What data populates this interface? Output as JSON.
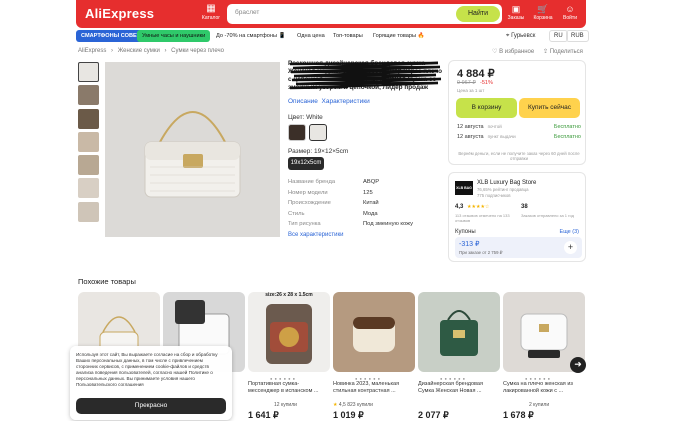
{
  "header": {
    "logo": "AliExpress",
    "catalog_label": "Каталог",
    "search_placeholder": "браслет",
    "search_button": "Найти",
    "icons": [
      {
        "label": "Заказы",
        "icon": "package-icon"
      },
      {
        "label": "Корзина",
        "icon": "cart-icon"
      },
      {
        "label": "Войти",
        "icon": "user-icon"
      }
    ]
  },
  "nav": {
    "chips": [
      "СМАРТФОНЫ СОВЕТ",
      "Умные часы и наушники",
      "До -70% на смартфоны 📱",
      "Одна цена",
      "Топ-товары",
      "Горящие товары 🔥"
    ],
    "location": "Гурьевск",
    "lang": "RU",
    "currency": "RUB"
  },
  "breadcrumb": [
    "AliExpress",
    "›",
    "Женские сумки",
    "›",
    "Сумки через плечо"
  ],
  "actions": {
    "favorite": "В избранное",
    "share": "Поделиться"
  },
  "product": {
    "title": "Роскошная дизайнерская брендовая сумка Женская модная сумка-мессенджер через плечо с цепочкой на каждый день, кожаная Сумка со змеиным узором и цепочкой, Лидер продаж",
    "tabs": [
      "Описание",
      "Характеристики"
    ],
    "color_label": "Цвет: White",
    "size_label": "Размер: 19×12×5cm",
    "size_option": "19x12x5cm",
    "specs": [
      {
        "k": "Название бренда",
        "v": "ABQP"
      },
      {
        "k": "Номер модели",
        "v": "125"
      },
      {
        "k": "Происхождение",
        "v": "Китай"
      },
      {
        "k": "Стиль",
        "v": "Мода"
      },
      {
        "k": "Тип рисунка",
        "v": "Под змеиную кожу"
      }
    ],
    "all_specs": "Все характеристики"
  },
  "buy": {
    "price": "4 884 ₽",
    "old_price": "9 967 ₽",
    "discount": "-51%",
    "price_note": "Цена за 1 шт",
    "cart_button": "В корзину",
    "buy_now_button": "Купить сейчас",
    "delivery": [
      {
        "date": "12 августа",
        "type": "почтой",
        "price": "Бесплатно"
      },
      {
        "date": "12 августа",
        "type": "пункт выдачи",
        "price": "Бесплатно"
      }
    ],
    "note": "Вернём деньги, если не получите заказ через 60 дней после отправки"
  },
  "store": {
    "logo": "XLB BAG",
    "name": "XLB Luxury Bag Store",
    "positive": "76,65% рейтинг продавца",
    "subs": "775 подписчиков",
    "rating": "4,3",
    "rating_desc": "113 отзывов отмечено на 133 отзывов",
    "orders": "38",
    "orders_desc": "Заказов отправлено за 1 год",
    "coupons_label": "Купоны",
    "coupons_more": "Еще (3)",
    "coupon_value": "-313 ₽",
    "coupon_desc": "При заказе от 2 759 ₽"
  },
  "similar": {
    "title": "Похожие товары",
    "cards": [
      {
        "name": "",
        "price": "",
        "rating": "",
        "sold": "",
        "size": ""
      },
      {
        "name": "",
        "price": "",
        "rating": "",
        "sold": "",
        "size": ""
      },
      {
        "name": "Портативная сумка-мессенджер в испанском ...",
        "price": "1 641 ₽",
        "rating": "",
        "sold": "12 купили",
        "size": "size:26 x 28 x 1.5cm"
      },
      {
        "name": "Новинка 2023, маленькая стильная контрастная ...",
        "price": "1 019 ₽",
        "rating": "4,5",
        "sold": "823 купили",
        "size": ""
      },
      {
        "name": "Дизайнерская брендовая Сумка Женская Новая ...",
        "price": "2 077 ₽",
        "rating": "",
        "sold": "",
        "size": ""
      },
      {
        "name": "Сумка на плечо женская из лакированной кожи с ...",
        "price": "1 678 ₽",
        "rating": "",
        "sold": "2 купили",
        "size": ""
      }
    ]
  },
  "cookie": {
    "text": "Используя этот сайт, Вы выражаете согласие на сбор и обработку Ваших персональных данных, в том числе с привлечением сторонних сервисов, с применением cookie-файлов и средств анализа поведения пользователей, согласно нашей Политике о персональных данных. Вы принимаете условия нашего Пользовательского соглашения",
    "button": "Прекрасно"
  }
}
